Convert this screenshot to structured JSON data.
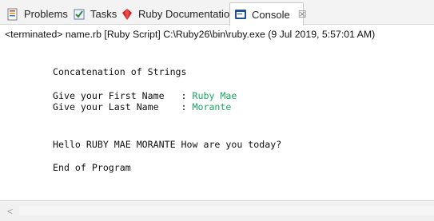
{
  "tabs": [
    {
      "label": "Problems",
      "icon": "problems-icon"
    },
    {
      "label": "Tasks",
      "icon": "tasks-icon"
    },
    {
      "label": "Ruby Documentation",
      "icon": "ruby-doc-icon"
    },
    {
      "label": "Console",
      "icon": "console-icon",
      "active": true,
      "close": "☒"
    }
  ],
  "status": {
    "text": "<terminated> name.rb [Ruby Script] C:\\Ruby26\\bin\\ruby.exe (9 Jul 2019, 5:57:01 AM)"
  },
  "console": {
    "title": "Concatenation of Strings",
    "first_prompt": "Give your First Name   : ",
    "first_value": "Ruby Mae",
    "last_prompt": "Give your Last Name    : ",
    "last_value": "Morante",
    "greeting": "Hello RUBY MAE MORANTE How are you today?",
    "end": "End of Program"
  },
  "scrollbar": {
    "left_arrow": "<"
  },
  "colors": {
    "input_text": "#1aa660",
    "accent_tab": "#ffffff"
  }
}
